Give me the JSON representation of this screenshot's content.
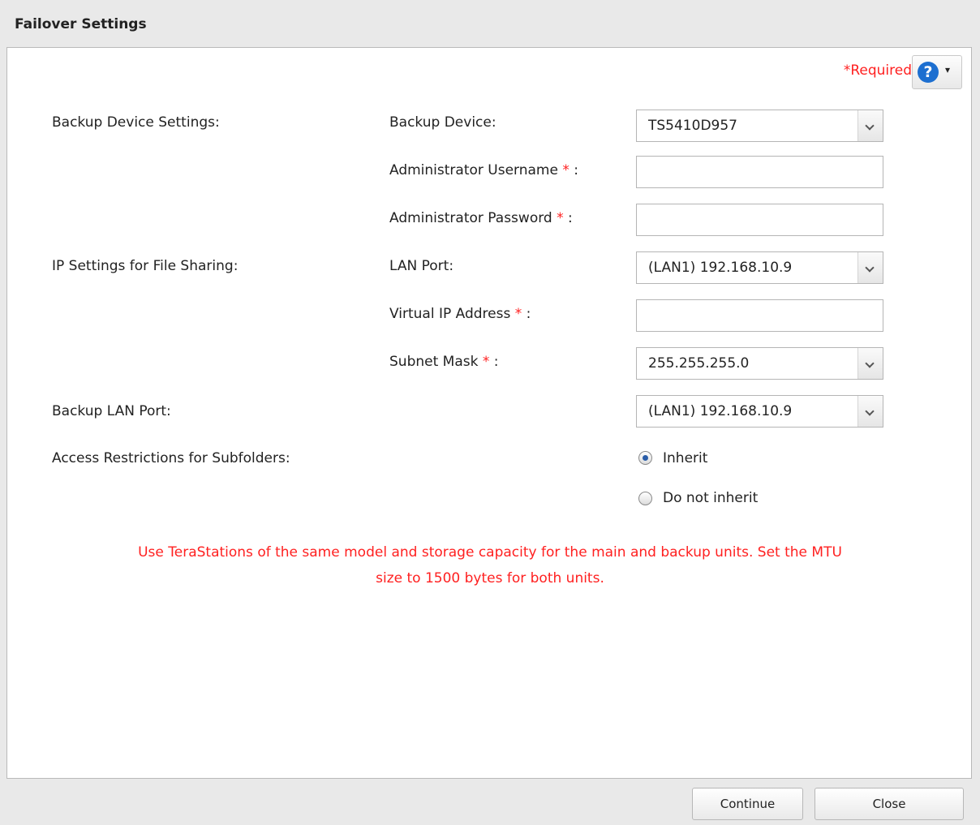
{
  "window": {
    "title": "Failover Settings"
  },
  "header": {
    "required_label": "*Required",
    "help_icon": "question-circle-icon",
    "help_caret": "▾"
  },
  "form": {
    "section_backup_device": "Backup Device Settings:",
    "backup_device_label": "Backup Device:",
    "backup_device_value": "TS5410D957",
    "admin_username_label": "Administrator Username",
    "admin_username_value": "",
    "admin_password_label": "Administrator Password",
    "admin_password_value": "",
    "section_ip_settings": "IP Settings for File Sharing:",
    "lan_port_label": "LAN Port:",
    "lan_port_value": "(LAN1) 192.168.10.9",
    "virtual_ip_label": "Virtual IP Address",
    "virtual_ip_value": "",
    "subnet_mask_label": "Subnet Mask",
    "subnet_mask_value": "255.255.255.0",
    "backup_lan_port_label": "Backup LAN Port:",
    "backup_lan_port_value": "(LAN1) 192.168.10.9",
    "access_restrictions_label": "Access Restrictions for Subfolders:",
    "inherit_label": "Inherit",
    "do_not_inherit_label": "Do not inherit",
    "selected_access_option": "Inherit",
    "asterisk": "*",
    "colon": ":"
  },
  "note": {
    "line1": "Use TeraStations of the same model and storage capacity for the main and backup units. Set the MTU",
    "line2": "size to 1500 bytes for both units."
  },
  "footer": {
    "continue_label": "Continue",
    "close_label": "Close"
  },
  "colors": {
    "warning_red": "#ff2020",
    "help_blue": "#1d6fd0",
    "dialog_bg": "#e9e9e9"
  }
}
